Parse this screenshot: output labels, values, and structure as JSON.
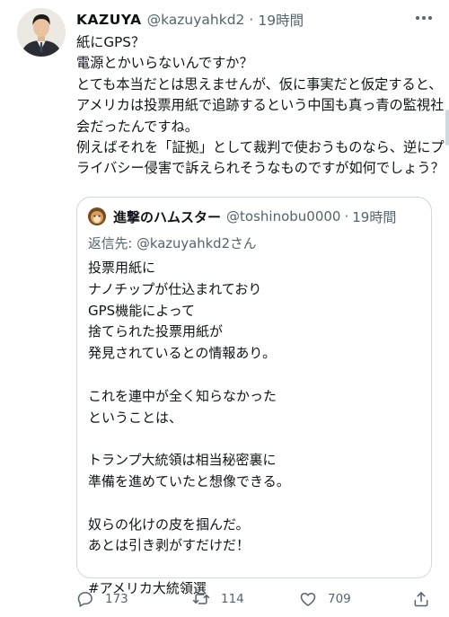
{
  "tweet": {
    "display_name": "KAZUYA",
    "handle": "@kazuyahkd2",
    "separator": "·",
    "time": "19時間",
    "text": "紙にGPS？\n電源とかいらないんですか？\nとても本当だとは思えませんが、仮に事実だと仮定すると、アメリカは投票用紙で追跡するという中国も真っ青の監視社会だったんですね。\n例えばそれを「証拠」として裁判で使おうものなら、逆にプライバシー侵害で訴えられそうなものですが如何でしょう？"
  },
  "quoted_tweet": {
    "display_name": "進撃のハムスター",
    "handle": "@toshinobu0000",
    "separator": "·",
    "time": "19時間",
    "reply_prefix": "返信先: ",
    "reply_to": "@kazuyahkd2さん",
    "text": "投票用紙に\nナノチップが仕込まれており\nGPS機能によって\n捨てられた投票用紙が\n発見されているとの情報あり。\n\nこれを連中が全く知らなかった\nということは、\n\nトランプ大統領は相当秘密裏に\n準備を進めていたと想像できる。\n\n奴らの化けの皮を掴んだ。\nあとは引き剥がすだけだ！\n\n#アメリカ大統領選"
  },
  "actions": {
    "reply_count": "173",
    "retweet_count": "114",
    "like_count": "709"
  },
  "colors": {
    "text": "#0f1419",
    "secondary": "#536471",
    "border": "#cfd9de"
  },
  "icons": [
    "more-icon",
    "reply-icon",
    "retweet-icon",
    "like-icon",
    "share-icon"
  ]
}
